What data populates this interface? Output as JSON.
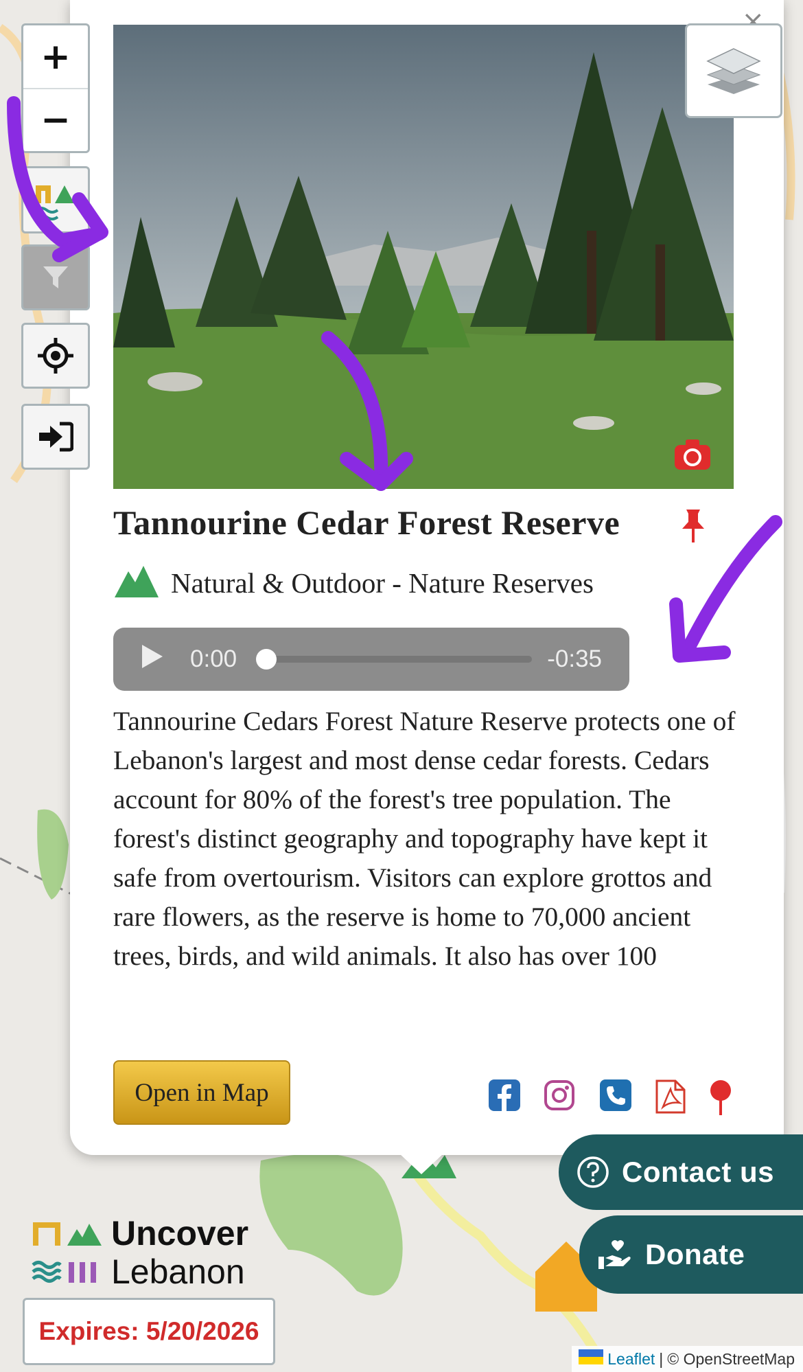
{
  "map_controls": {
    "zoom_in": "+",
    "zoom_out": "−"
  },
  "popup": {
    "title": "Tannourine Cedar Forest Reserve",
    "category": "Natural & Outdoor - Nature Reserves",
    "audio": {
      "current_time": "0:00",
      "remaining_time": "-0:35",
      "progress": 0
    },
    "description": "Tannourine Cedars Forest Nature Reserve protects one of Lebanon's largest and most dense cedar forests. Cedars account for 80% of the forest's tree population. The forest's distinct geography and topography have kept it safe from overtourism. Visitors can explore grottos and rare flowers, as the reserve is home to 70,000 ancient trees, birds, and wild animals. It also has over 100",
    "open_in_map_label": "Open in Map",
    "close_label": "×",
    "social_icons": [
      "facebook-icon",
      "instagram-icon",
      "phone-icon",
      "pdf-icon",
      "location-pin-icon"
    ]
  },
  "floating": {
    "contact_label": "Contact us",
    "donate_label": "Donate"
  },
  "logo": {
    "line1": "Uncover",
    "line2": "Lebanon"
  },
  "expires_label": "Expires: 5/20/2026",
  "attribution": {
    "leaflet": "Leaflet",
    "separator": "|",
    "osm": "© OpenStreetMap"
  },
  "colors": {
    "teal": "#1e5a5e",
    "gold": "#e2ad2b",
    "green": "#3fa35a",
    "red": "#d02b2b",
    "annotation_purple": "#8a2be2"
  }
}
